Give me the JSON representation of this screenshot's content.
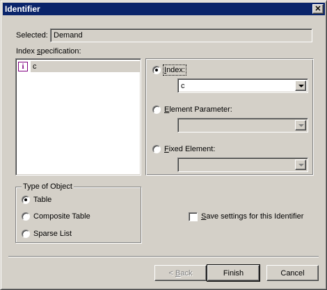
{
  "window": {
    "title": "Identifier",
    "close_glyph": "✕"
  },
  "selected": {
    "label": "Selected:",
    "value": "Demand"
  },
  "index_spec": {
    "label_prefix": "Index ",
    "label_accel": "s",
    "label_suffix": "pecification:",
    "items": [
      {
        "icon": "i",
        "icon_name": "index-icon",
        "label": "c"
      }
    ]
  },
  "options": {
    "index": {
      "accel": "I",
      "rest": "ndex:",
      "checked": true,
      "value": "c"
    },
    "element_parameter": {
      "accel": "E",
      "rest": "lement Parameter:",
      "checked": false,
      "value": ""
    },
    "fixed_element": {
      "accel": "F",
      "rest": "ixed Element:",
      "checked": false,
      "value": ""
    }
  },
  "type_of_object": {
    "legend": "Type of Object",
    "choices": [
      {
        "label": "Table",
        "checked": true
      },
      {
        "label": "Composite Table",
        "checked": false
      },
      {
        "label": "Sparse List",
        "checked": false
      }
    ]
  },
  "save_settings": {
    "accel": "S",
    "rest": "ave settings for this Identifier",
    "checked": false
  },
  "buttons": {
    "back": {
      "prefix": "< ",
      "accel": "B",
      "rest": "ack",
      "enabled": false
    },
    "finish": {
      "label": "Finish"
    },
    "cancel": {
      "label": "Cancel"
    }
  },
  "colors": {
    "titlebar": "#0a246a",
    "face": "#d4d0c8",
    "index_icon": "#800080"
  }
}
